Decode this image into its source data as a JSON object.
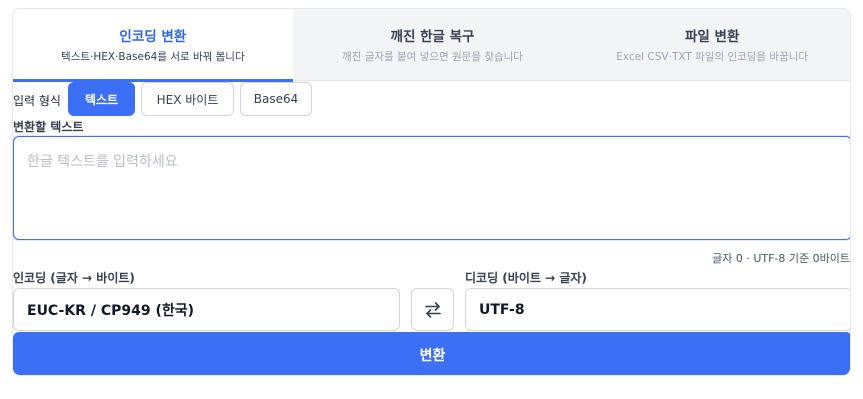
{
  "tabs": [
    {
      "title": "인코딩 변환",
      "subtitle": "텍스트·HEX·Base64를 서로 바꿔 봅니다"
    },
    {
      "title": "깨진 한글 복구",
      "subtitle": "깨진 글자를 붙여 넣으면 원문을 찾습니다"
    },
    {
      "title": "파일 변환",
      "subtitle": "Excel CSV·TXT 파일의 인코딩을 바꿉니다"
    }
  ],
  "format": {
    "label": "입력 형식",
    "options": [
      "텍스트",
      "HEX 바이트",
      "Base64"
    ],
    "selected": "텍스트"
  },
  "text_input": {
    "label": "변환할 텍스트",
    "placeholder": "한글 텍스트를 입력하세요",
    "value": "",
    "count": "글자 0 · UTF-8 기준 0바이트"
  },
  "encode": {
    "label": "인코딩 (글자 → 바이트)",
    "value": "EUC-KR / CP949 (한국)"
  },
  "decode": {
    "label": "디코딩 (바이트 → 글자)",
    "value": "UTF-8"
  },
  "swap_icon": "swap-arrows-icon",
  "convert_label": "변환",
  "colors": {
    "accent": "#3b6ff5",
    "tab_active_text": "#2f66e6"
  }
}
